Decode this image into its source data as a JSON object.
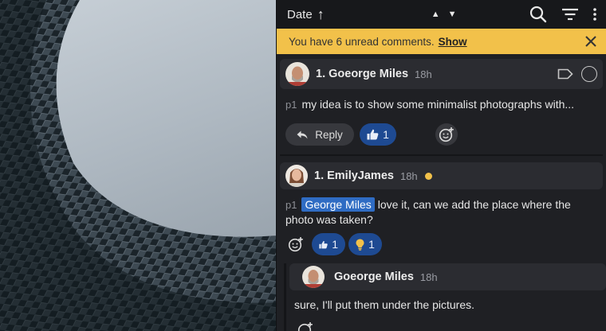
{
  "toolbar": {
    "sort_label": "Date",
    "sort_arrow": "↑",
    "icons": [
      "arrow-up-icon",
      "arrow-down-icon",
      "search-icon",
      "filter-icon",
      "more-icon"
    ]
  },
  "banner": {
    "message": "You have 6 unread comments.",
    "action": "Show",
    "close_icon": "close-icon"
  },
  "comments": [
    {
      "author": "1. Goeorge Miles",
      "time": "18h",
      "tag": "p1",
      "text": "my idea is to show some minimalist photographs with...",
      "reply_label": "Reply",
      "reactions": [
        {
          "icon": "thumbs-up-icon",
          "count": "1"
        }
      ]
    },
    {
      "author": "1. EmilyJames",
      "time": "18h",
      "unread": true,
      "tag": "p1",
      "mention": "George Miles",
      "text": "love it, can we add the place where the photo was taken?",
      "reactions": [
        {
          "icon": "thumbs-up-icon",
          "count": "1"
        },
        {
          "icon": "lightbulb-icon",
          "count": "1"
        }
      ]
    },
    {
      "author": "Goeorge Miles",
      "time": "18h",
      "text": "sure, I'll put them under the pictures."
    }
  ],
  "colors": {
    "banner": "#f2c14a",
    "reaction": "#1e4a92",
    "mention": "#2f6cc3",
    "unread_dot": "#f2c14a"
  }
}
